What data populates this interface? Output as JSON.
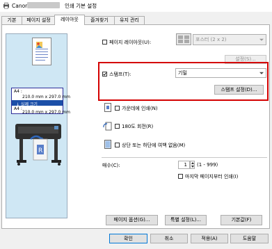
{
  "window": {
    "title_suffix": "인쇄 기본 설정"
  },
  "tabs": [
    "기본",
    "페이지 설정",
    "레이아웃",
    "즐겨찾기",
    "유지 관리"
  ],
  "active_tab": 2,
  "preview": {
    "line1_label": "A4 :",
    "line1_size": "210.0 mm x 297.0 mm",
    "selected_label": "↓ 실제 크기",
    "line2_label": "A4 :",
    "line2_size": "210.0 mm x 297.0 mm"
  },
  "page_layout": {
    "checkbox_label": "페이지 레이아웃(U):",
    "checked": false,
    "select_value": "포스터 (2 x 2)",
    "settings_button": "설정(S)..."
  },
  "stamp": {
    "checkbox_label": "스탬프(T):",
    "checked": true,
    "select_value": "기밀",
    "settings_button": "스탬프 설정(D)..."
  },
  "options": [
    {
      "label": "가운데에 인쇄(N)",
      "checked": false
    },
    {
      "label": "180도 회전(R)",
      "checked": false
    },
    {
      "label": "상단 또는 하단에 여백 없음(M)",
      "checked": false
    }
  ],
  "copies": {
    "label": "매수(C):",
    "value": "1",
    "range": "(1 - 999)",
    "reverse_label": "마지막 페이지부터 인쇄(I)",
    "reverse_checked": false
  },
  "panel_buttons": {
    "page_options": "페이지 옵션(G)...",
    "special_settings": "특별 설정(L)...",
    "defaults": "기본값(F)"
  },
  "dialog_buttons": {
    "ok": "확인",
    "cancel": "취소",
    "apply": "적용(A)",
    "help": "도움말"
  },
  "colors": {
    "highlight_frame": "#d40000",
    "selection": "#1b4fa8",
    "accent": "#0078d7"
  }
}
